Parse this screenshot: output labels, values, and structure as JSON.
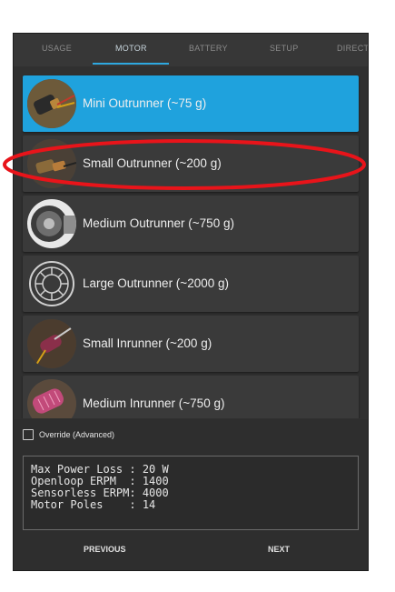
{
  "tabs": [
    "USAGE",
    "MOTOR",
    "BATTERY",
    "SETUP",
    "DIRECT"
  ],
  "active_tab": "MOTOR",
  "motors": [
    {
      "label": "Mini Outrunner (~75 g)",
      "selected": true,
      "icon": "mini-outrunner-photo"
    },
    {
      "label": "Small Outrunner (~200 g)",
      "selected": false,
      "icon": "small-outrunner-photo"
    },
    {
      "label": "Medium Outrunner (~750 g)",
      "selected": false,
      "icon": "medium-outrunner-photo"
    },
    {
      "label": "Large Outrunner (~2000 g)",
      "selected": false,
      "icon": "large-outrunner-drawing"
    },
    {
      "label": "Small Inrunner (~200 g)",
      "selected": false,
      "icon": "small-inrunner-photo"
    },
    {
      "label": "Medium Inrunner (~750 g)",
      "selected": false,
      "icon": "medium-inrunner-photo"
    }
  ],
  "override": {
    "label": "Override (Advanced)",
    "checked": false
  },
  "info_lines": [
    "Max Power Loss : 20 W",
    "Openloop ERPM  : 1400",
    "Sensorless ERPM: 4000",
    "Motor Poles    : 14"
  ],
  "nav": {
    "previous": "PREVIOUS",
    "next": "NEXT"
  },
  "colors": {
    "accent": "#1fa2dd",
    "annotation": "#e8141a"
  }
}
